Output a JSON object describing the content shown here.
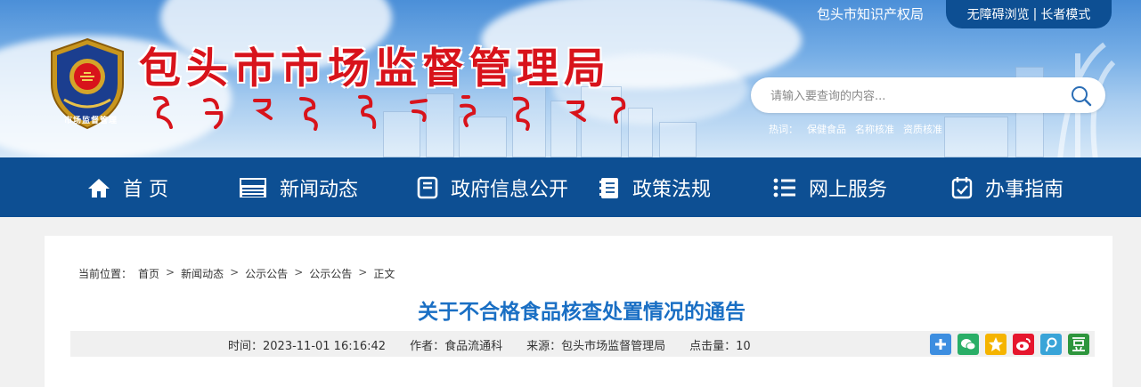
{
  "header": {
    "title": "包头市市场监督管理局",
    "emblem_text": "市场监督管理",
    "ip_link": "包头市知识产权局",
    "access": {
      "barrier_free": "无障碍浏览",
      "separator": "|",
      "elder_mode": "长者模式"
    },
    "search": {
      "placeholder": "请输入要查询的内容..."
    },
    "hot": {
      "label": "热词：",
      "items": [
        "保健食品",
        "名称核准",
        "资质核准"
      ]
    }
  },
  "nav": {
    "items": [
      {
        "label": "首 页",
        "icon": "home-icon"
      },
      {
        "label": "新闻动态",
        "icon": "news-icon"
      },
      {
        "label": "政府信息公开",
        "icon": "document-icon"
      },
      {
        "label": "政策法规",
        "icon": "book-icon"
      },
      {
        "label": "网上服务",
        "icon": "list-icon"
      },
      {
        "label": "办事指南",
        "icon": "guide-icon"
      }
    ]
  },
  "breadcrumb": {
    "label": "当前位置：",
    "items": [
      "首页",
      "新闻动态",
      "公示公告",
      "公示公告",
      "正文"
    ],
    "separator": ">"
  },
  "article": {
    "title": "关于不合格食品核查处置情况的通告",
    "time": "时间：2023-11-01 16:16:42",
    "author": "作者：食品流通科",
    "source": "来源：包头市场监督管理局",
    "clicks": "点击量：10"
  },
  "share": {
    "items": [
      {
        "icon": "plus-share-icon",
        "color": "#3d8ee0"
      },
      {
        "icon": "wechat-icon",
        "color": "#2aae67"
      },
      {
        "icon": "qzone-icon",
        "color": "#f5b400"
      },
      {
        "icon": "weibo-icon",
        "color": "#e6162d"
      },
      {
        "icon": "tencent-weibo-icon",
        "color": "#39a4d8"
      },
      {
        "icon": "douban-icon",
        "color": "#2e963d"
      }
    ]
  },
  "colors": {
    "brand_blue": "#0d4f93",
    "title_red": "#d8131b",
    "article_title": "#1a6fc4"
  }
}
